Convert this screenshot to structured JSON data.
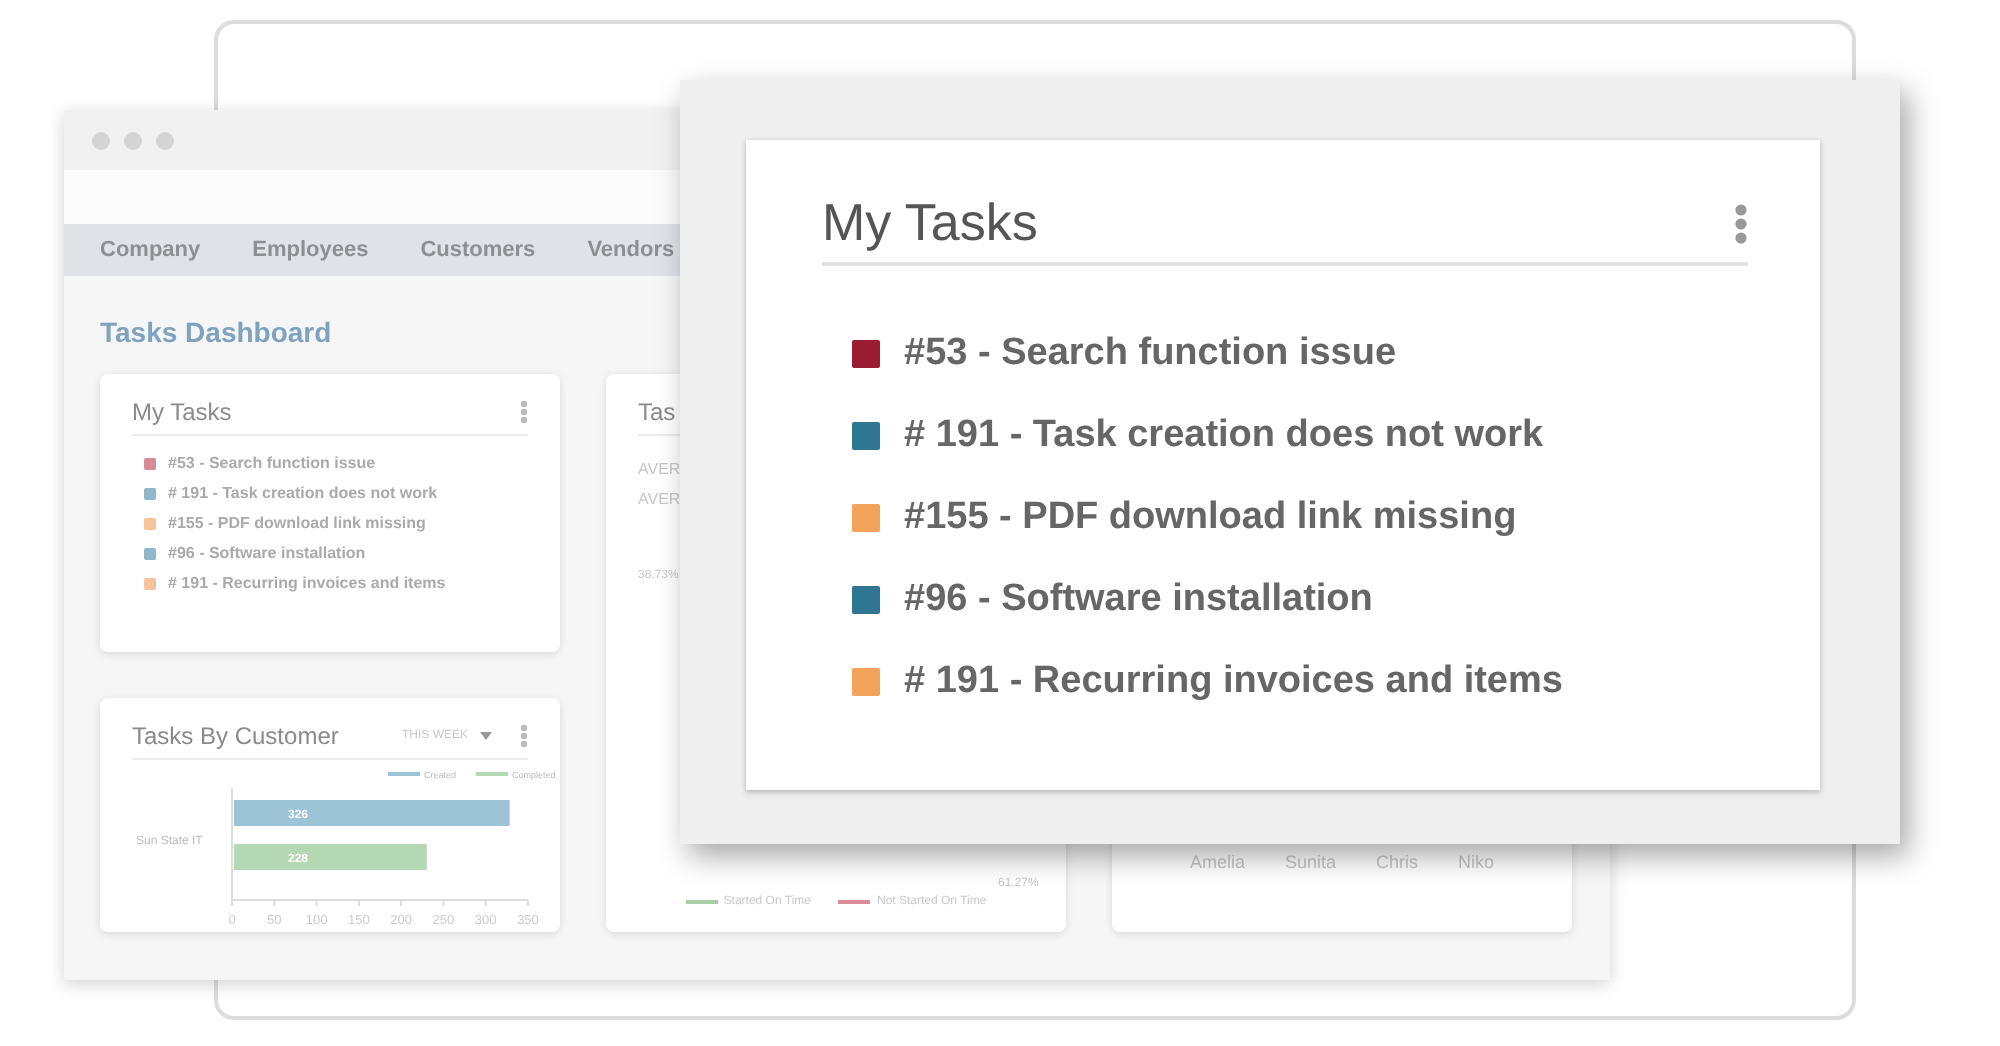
{
  "back_window": {
    "nav_tabs": [
      {
        "label": "Company",
        "selected": false
      },
      {
        "label": "Employees",
        "selected": false
      },
      {
        "label": "Customers",
        "selected": false
      },
      {
        "label": "Vendors",
        "selected": false
      }
    ],
    "page_title": "Tasks Dashboard",
    "my_tasks_card": {
      "title": "My Tasks",
      "tasks": [
        {
          "label": "#53 - Search function issue",
          "color": "#d68c97"
        },
        {
          "label": "# 191 - Task creation does not work",
          "color": "#8fb6c9"
        },
        {
          "label": "#155 - PDF download link missing",
          "color": "#f6c49c"
        },
        {
          "label": "#96 - Software installation",
          "color": "#8fb6c9"
        },
        {
          "label": "# 191 - Recurring invoices and items",
          "color": "#f6c49c"
        }
      ]
    },
    "tasks_card": {
      "title": "Tas",
      "rows": [
        "AVER",
        "AVER"
      ],
      "readings": [
        "38.73%",
        "61.27%"
      ],
      "legend": [
        {
          "label": "Started On Time",
          "color": "#a9d0a9"
        },
        {
          "label": "Not Started On Time",
          "color": "#d98b96"
        }
      ]
    },
    "customer_card": {
      "title": "Tasks By Customer",
      "period": "THIS WEEK",
      "chart_data": {
        "type": "bar",
        "orientation": "horizontal",
        "categories": [
          "Sun State IT"
        ],
        "series": [
          {
            "name": "Created",
            "color": "#9cc3d6",
            "values": [
              326
            ]
          },
          {
            "name": "Completed",
            "color": "#b4d8b4",
            "values": [
              228
            ]
          }
        ],
        "xlim": [
          0,
          350
        ],
        "xticks": [
          0,
          50,
          100,
          150,
          200,
          250,
          300,
          350
        ],
        "data_labels": true,
        "legend": "top-right"
      }
    },
    "people_card": {
      "names": [
        "Amelia",
        "Sunita",
        "Chris",
        "Niko"
      ]
    }
  },
  "focus_card": {
    "title": "My Tasks",
    "tasks": [
      {
        "label": "#53 - Search function issue",
        "color": "#9b1c32"
      },
      {
        "label": "# 191 - Task creation does not work",
        "color": "#2f7594"
      },
      {
        "label": "#155 - PDF download link missing",
        "color": "#f3a25a"
      },
      {
        "label": "#96 - Software installation",
        "color": "#2f7594"
      },
      {
        "label": "# 191 - Recurring invoices and items",
        "color": "#f3a25a"
      }
    ]
  }
}
